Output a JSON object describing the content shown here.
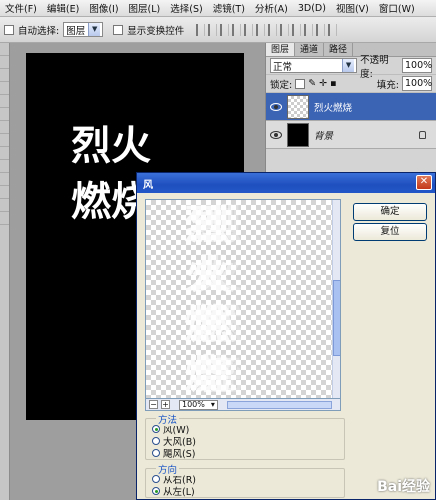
{
  "menu": [
    "文件(F)",
    "编辑(E)",
    "图像(I)",
    "图层(L)",
    "选择(S)",
    "滤镜(T)",
    "分析(A)",
    "3D(D)",
    "视图(V)",
    "窗口(W)"
  ],
  "options": {
    "auto_select": "自动选择:",
    "auto_select_value": "图层",
    "show_transform": "显示变换控件"
  },
  "canvas_text": "烈火燃烧",
  "layers_panel": {
    "tabs": [
      "图层",
      "通道",
      "路径"
    ],
    "blend_mode": "正常",
    "opacity_label": "不透明度:",
    "opacity_value": "100%",
    "lock_label": "锁定:",
    "fill_label": "填充:",
    "fill_value": "100%",
    "layers": [
      {
        "name": "烈火燃烧",
        "selected": true
      },
      {
        "name": "背景",
        "selected": false
      }
    ]
  },
  "dialog": {
    "title": "风",
    "ok": "确定",
    "reset": "复位",
    "zoom": "100%",
    "method_title": "方法",
    "methods": [
      "风(W)",
      "大风(B)",
      "飓风(S)"
    ],
    "direction_title": "方向",
    "directions": [
      "从右(R)",
      "从左(L)"
    ]
  },
  "watermark": "Bai经验"
}
